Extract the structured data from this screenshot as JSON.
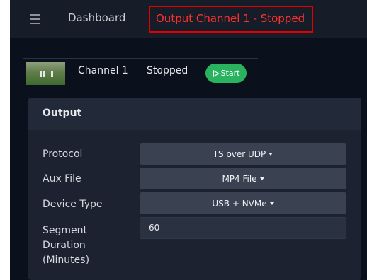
{
  "topbar": {
    "menu_icon": "hamburger-menu-icon",
    "dashboard_label": "Dashboard",
    "status_text": "Output Channel 1 - Stopped",
    "status_color": "#ff3030",
    "highlight_color": "#e00000"
  },
  "channel": {
    "name": "Channel 1",
    "state": "Stopped",
    "start_label": "Start",
    "start_icon": "play-outline-icon",
    "start_color": "#29b35f"
  },
  "output_panel": {
    "title": "Output",
    "protocol": {
      "label": "Protocol",
      "value": "TS over UDP"
    },
    "aux_file": {
      "label": "Aux File",
      "value": "MP4 File"
    },
    "device_type": {
      "label": "Device Type",
      "value": "USB + NVMe"
    },
    "segment_duration": {
      "label_line1": "Segment",
      "label_line2": "Duration",
      "label_line3": "(Minutes)",
      "value": "60"
    }
  }
}
